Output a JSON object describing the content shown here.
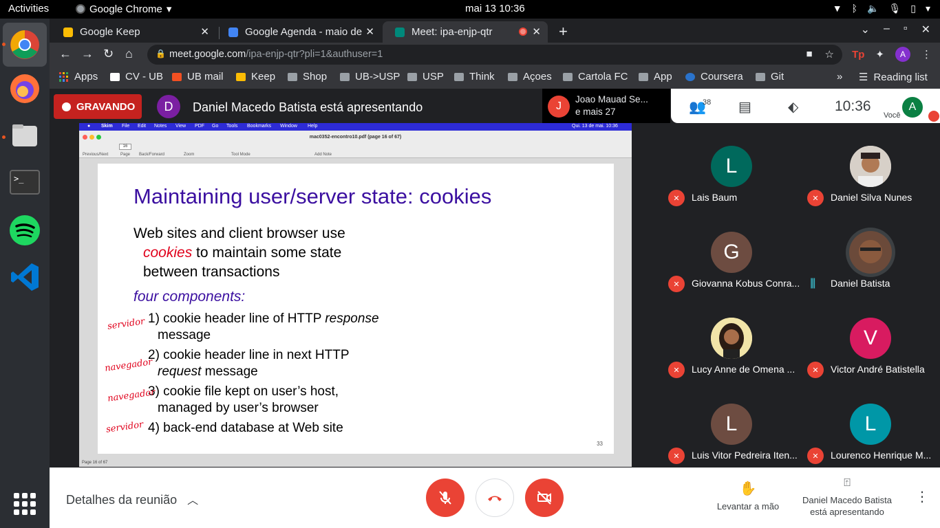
{
  "topbar": {
    "activities": "Activities",
    "app": "Google Chrome",
    "clock": "mai 13  10:36"
  },
  "tabs": [
    {
      "title": "Google Keep",
      "color": "#fbbc04"
    },
    {
      "title": "Google Agenda - maio de",
      "color": "#4285f4"
    },
    {
      "title": "Meet: ipa-enjp-qtr",
      "color": "#00897b"
    }
  ],
  "url": {
    "host": "meet.google.com",
    "path": "/ipa-enjp-qtr?pli=1&authuser=1"
  },
  "profile_initial": "A",
  "bookmarks": [
    "Apps",
    "CV - UB",
    "UB mail",
    "Keep",
    "Shop",
    "UB->USP",
    "USP",
    "Think",
    "Açoes",
    "Cartola FC",
    "App",
    "Coursera",
    "Git"
  ],
  "reading_list": "Reading list",
  "meet": {
    "recording": "GRAVANDO",
    "presenter_initial": "D",
    "presenter_text": "Daniel Macedo Batista está apresentando",
    "chat_initial": "J",
    "chat_name": "Joao Mauad Se...",
    "chat_more": "e mais 27",
    "participant_count": "38",
    "time": "10:36",
    "you_label": "Você",
    "you_initial": "A"
  },
  "mac": {
    "app": "Skim",
    "menus": [
      "File",
      "Edit",
      "Notes",
      "View",
      "PDF",
      "Go",
      "Tools",
      "Bookmarks",
      "Window",
      "Help"
    ],
    "date": "Qui. 13 de mai.  10:36",
    "doc_title": "mac0352-encontro10.pdf (page 16 of 67)",
    "page_field": "16",
    "toolbar_labels": [
      "Previous/Next",
      "Page",
      "Back/Forward",
      "Zoom",
      "Tool Mode",
      "Add Note"
    ],
    "footer": "Page 16 of 67"
  },
  "slide": {
    "title": "Maintaining user/server state: cookies",
    "l1": "Web sites and client browser  use",
    "l2a": "cookies",
    "l2b": " to maintain some state",
    "l3": "between transactions",
    "l4": "four components:",
    "i1a": "1) cookie header line of HTTP ",
    "i1b": "response",
    "i1c": "message",
    "i2a": "2) cookie header line in next HTTP",
    "i2b": "request",
    "i2c": " message",
    "i3a": "3) cookie file kept on user’s host,",
    "i3b": "managed by user’s browser",
    "i4": "4) back-end database at Web site",
    "page": "33",
    "scribbles": [
      "servidor",
      "navegador",
      "navegador",
      "servidor"
    ]
  },
  "participants": [
    {
      "name": "Lais Baum",
      "initial": "L",
      "color": "#00695c",
      "muted": true
    },
    {
      "name": "Daniel Silva Nunes",
      "initial": "",
      "color": "#c9c2bb",
      "muted": true
    },
    {
      "name": "Giovanna Kobus Conra...",
      "initial": "G",
      "color": "#6d4c41",
      "muted": true
    },
    {
      "name": "Daniel Batista",
      "initial": "",
      "color": "#8d6e63",
      "muted": false
    },
    {
      "name": "Lucy Anne de Omena ...",
      "initial": "",
      "color": "#f3e5ab",
      "muted": true
    },
    {
      "name": "Victor André Batistella",
      "initial": "V",
      "color": "#d81b60",
      "muted": true
    },
    {
      "name": "Luis Vitor Pedreira Iten...",
      "initial": "L",
      "color": "#6d4c41",
      "muted": true
    },
    {
      "name": "Lourenco Henrique M...",
      "initial": "L",
      "color": "#0097a7",
      "muted": true
    }
  ],
  "bottom": {
    "details": "Detalhes da reunião",
    "raise_hand": "Levantar a mão",
    "presenting_1": "Daniel Macedo Batista",
    "presenting_2": "está apresentando"
  }
}
